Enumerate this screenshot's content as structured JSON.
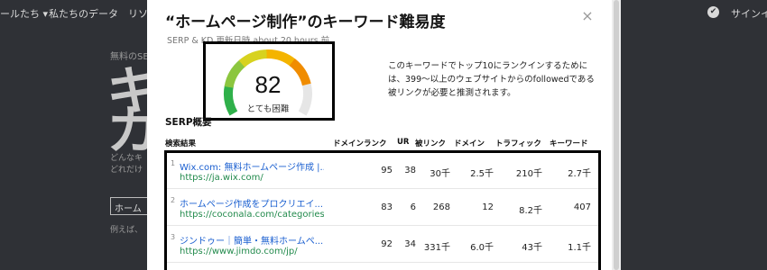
{
  "background": {
    "nav_items": [
      "ールたち ▾",
      "私たちのデータ",
      "リソ"
    ],
    "signin": "サインイ",
    "globe": "✔",
    "hero_small": "無料のSE",
    "hero_big_1": "キ",
    "hero_big_2": "カ",
    "hero_sub_1": "どんなキ",
    "hero_sub_2": "どれだけ",
    "input_value": "ホーム",
    "example": "例えば、"
  },
  "modal": {
    "title": "“ホームページ制作”のキーワード難易度",
    "close_icon": "×",
    "updated": "SERP & KD 更新日時 about 20 hours 前",
    "difficulty": {
      "score": "82",
      "label": "とても困難",
      "score_fraction": 0.82,
      "colors": [
        "#2fb04a",
        "#8cc63f",
        "#d7d21f",
        "#f4b400",
        "#f08c00",
        "#e6e6e6"
      ]
    },
    "description": "このキーワードでトップ10にランクインするためには、399〜以上のウェブサイトからのfollowedである被リンクが必要と推測されます。",
    "serp_heading": "SERP概要",
    "columns": {
      "result": "検索結果",
      "dr": "ドメインランク",
      "ur": "UR",
      "backlinks": "被リンク",
      "domains": "ドメイン",
      "traffic": "トラフィック",
      "keywords": "キーワード"
    },
    "rows": [
      {
        "num": "1",
        "title": "Wix.com: 無料ホームページ作成 |...",
        "url": "https://ja.wix.com/",
        "dr": "95",
        "ur": "38",
        "backlinks": "30千",
        "domains": "2.5千",
        "traffic": "210千",
        "keywords": "2.7千"
      },
      {
        "num": "2",
        "title": "ホームページ作成をプロクリエイ...",
        "url": "https://coconala.com/categories...",
        "dr": "83",
        "ur": "6",
        "backlinks": "268",
        "domains": "12",
        "traffic": "8.2千",
        "keywords": "407"
      },
      {
        "num": "3",
        "title": "ジンドゥー｜簡単・無料ホームペ...",
        "url": "https://www.jimdo.com/jp/",
        "dr": "92",
        "ur": "34",
        "backlinks": "331千",
        "domains": "6.0千",
        "traffic": "43千",
        "keywords": "1.1千"
      }
    ]
  }
}
